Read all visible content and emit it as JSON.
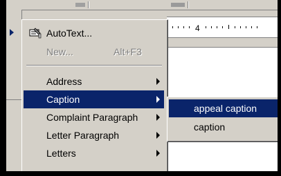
{
  "main_menu": {
    "items": [
      {
        "label": "AutoText...",
        "shortcut": "",
        "disabled": false,
        "submenu": false,
        "icon": "autotext-icon"
      },
      {
        "label": "New...",
        "shortcut": "Alt+F3",
        "disabled": true,
        "submenu": false
      },
      {
        "label": "Address",
        "submenu": true
      },
      {
        "label": "Caption",
        "submenu": true,
        "selected": true
      },
      {
        "label": "Complaint Paragraph",
        "submenu": true
      },
      {
        "label": "Letter Paragraph",
        "submenu": true
      },
      {
        "label": "Letters",
        "submenu": true
      }
    ]
  },
  "submenu": {
    "items": [
      {
        "label": "appeal caption",
        "selected": true
      },
      {
        "label": "caption",
        "selected": false
      }
    ]
  },
  "ruler": {
    "number": "4"
  },
  "colors": {
    "menu_bg": "#d4d0c8",
    "highlight": "#0a246a",
    "highlight_text": "#ffffff",
    "disabled_text": "#808080"
  }
}
